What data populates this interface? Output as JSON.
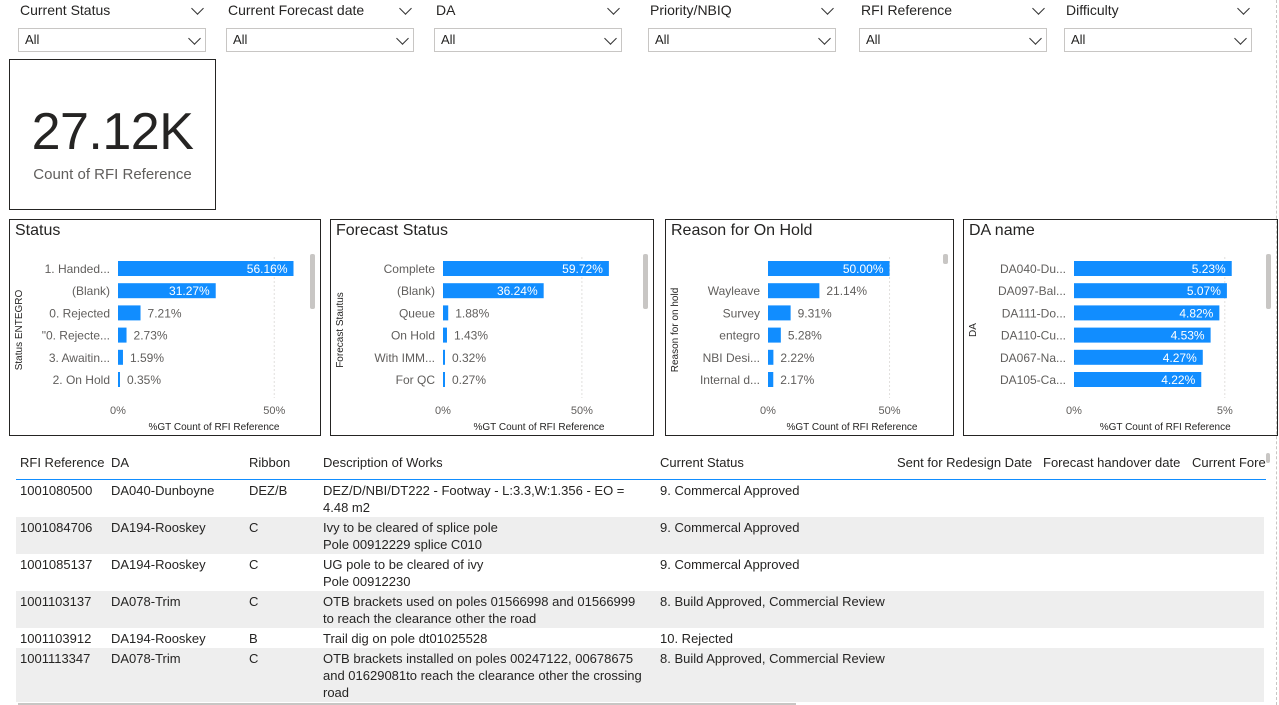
{
  "slicers": [
    {
      "title": "Current Status",
      "value": "All"
    },
    {
      "title": "Current Forecast date",
      "value": "All"
    },
    {
      "title": "DA",
      "value": "All"
    },
    {
      "title": "Priority/NBIQ",
      "value": "All"
    },
    {
      "title": "RFI Reference",
      "value": "All"
    },
    {
      "title": "Difficulty",
      "value": "All"
    }
  ],
  "kpi": {
    "value": "27.12K",
    "label": "Count of RFI Reference"
  },
  "colors": {
    "bar": "#118dff",
    "grid": "#e1dfdd"
  },
  "chart_data": [
    {
      "type": "bar",
      "orientation": "horizontal",
      "title": "Status",
      "ylabel": "Status ENTEGRO",
      "xlabel": "%GT Count of RFI Reference",
      "categories": [
        "1. Handed...",
        "(Blank)",
        "0. Rejected",
        "\"0. Rejecte...",
        "3. Awaitin...",
        "2. On Hold"
      ],
      "values": [
        56.16,
        31.27,
        7.21,
        2.73,
        1.59,
        0.35
      ],
      "labels": [
        "56.16%",
        "31.27%",
        "7.21%",
        "2.73%",
        "1.59%",
        "0.35%"
      ],
      "xticks": [
        "0%",
        "50%"
      ],
      "xlim": [
        0,
        64
      ]
    },
    {
      "type": "bar",
      "orientation": "horizontal",
      "title": "Forecast Status",
      "ylabel": "Forecast Stautus",
      "xlabel": "%GT Count of RFI Reference",
      "categories": [
        "Complete",
        "(Blank)",
        "Queue",
        "On Hold",
        "With IMM...",
        "For QC"
      ],
      "values": [
        59.72,
        36.24,
        1.88,
        1.43,
        0.32,
        0.27
      ],
      "labels": [
        "59.72%",
        "36.24%",
        "1.88%",
        "1.43%",
        "0.32%",
        "0.27%"
      ],
      "xticks": [
        "0%",
        "50%"
      ],
      "xlim": [
        0,
        72
      ]
    },
    {
      "type": "bar",
      "orientation": "horizontal",
      "title": "Reason for On Hold",
      "ylabel": "Reason for on hold",
      "xlabel": "%GT Count of RFI Reference",
      "categories": [
        "",
        "Wayleave",
        "Survey",
        "entegro",
        "NBI Desi...",
        "Internal d..."
      ],
      "values": [
        50.0,
        21.14,
        9.31,
        5.28,
        2.22,
        2.17
      ],
      "labels": [
        "50.00%",
        "21.14%",
        "9.31%",
        "5.28%",
        "2.22%",
        "2.17%"
      ],
      "xticks": [
        "0%",
        "50%"
      ],
      "xlim": [
        0,
        72
      ]
    },
    {
      "type": "bar",
      "orientation": "horizontal",
      "title": "DA name",
      "ylabel": "DA",
      "xlabel": "%GT Count of RFI Reference",
      "categories": [
        "DA040-Du...",
        "DA097-Bal...",
        "DA111-Do...",
        "DA110-Cu...",
        "DA067-Na...",
        "DA105-Ca..."
      ],
      "values": [
        5.23,
        5.07,
        4.82,
        4.53,
        4.27,
        4.22
      ],
      "labels": [
        "5.23%",
        "5.07%",
        "4.82%",
        "4.53%",
        "4.27%",
        "4.22%"
      ],
      "xticks": [
        "0%",
        "5%"
      ],
      "xlim": [
        0,
        6.3
      ]
    }
  ],
  "table": {
    "columns": [
      "RFI Reference",
      "DA",
      "Ribbon",
      "Description of Works",
      "Current Status",
      "Sent for Redesign Date",
      "Forecast handover date",
      "Current Fore"
    ],
    "rows": [
      {
        "ref": "1001080500",
        "da": "DA040-Dunboyne",
        "ribbon": "DEZ/B",
        "desc": [
          "DEZ/D/NBI/DT222 - Footway - L:3.3,W:1.356 - EO =",
          "4.48 m2"
        ],
        "status": "9. Commercal Approved"
      },
      {
        "ref": "1001084706",
        "da": "DA194-Rooskey",
        "ribbon": "C",
        "desc": [
          "Ivy to be cleared of splice pole",
          "Pole 00912229 splice C010"
        ],
        "status": "9. Commercal Approved"
      },
      {
        "ref": "1001085137",
        "da": "DA194-Rooskey",
        "ribbon": "C",
        "desc": [
          "UG pole to be cleared of ivy",
          "Pole 00912230"
        ],
        "status": "9. Commercal Approved"
      },
      {
        "ref": "1001103137",
        "da": "DA078-Trim",
        "ribbon": "C",
        "desc": [
          "OTB brackets used on poles 01566998 and 01566999",
          "to reach the clearance other the road"
        ],
        "status": "8. Build Approved, Commercial Review"
      },
      {
        "ref": "1001103912",
        "da": "DA194-Rooskey",
        "ribbon": "B",
        "desc": [
          "Trail dig on pole dt01025528"
        ],
        "status": "10. Rejected"
      },
      {
        "ref": "1001113347",
        "da": "DA078-Trim",
        "ribbon": "C",
        "desc": [
          "OTB brackets installed on poles 00247122, 00678675",
          "and 01629081to reach the clearance other the crossing",
          "road"
        ],
        "status": "8. Build Approved, Commercial Review"
      }
    ]
  }
}
